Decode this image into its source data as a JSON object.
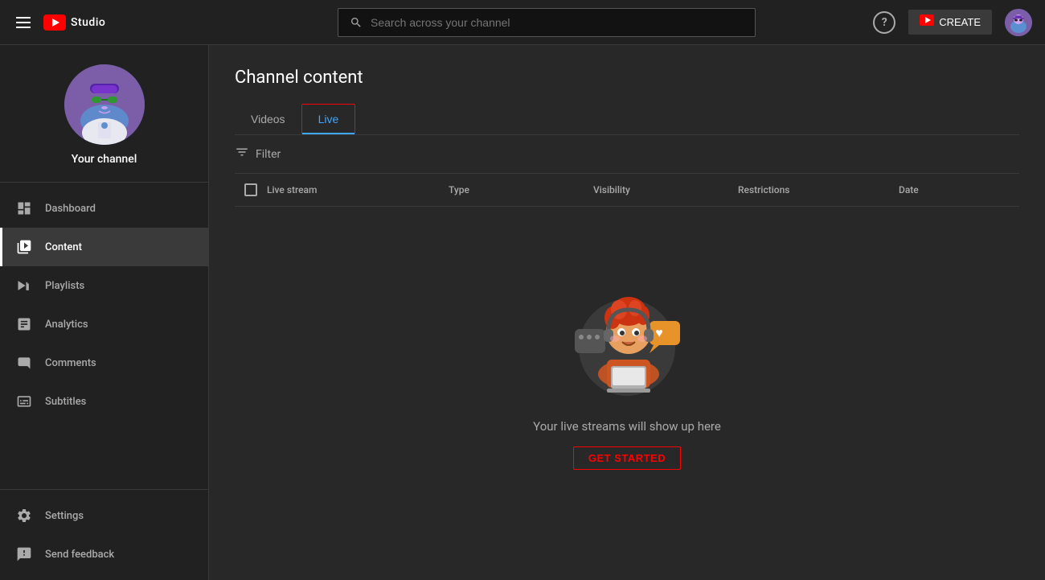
{
  "header": {
    "menu_icon": "☰",
    "logo_text": "Studio",
    "search_placeholder": "Search across your channel",
    "help_label": "?",
    "create_label": "CREATE",
    "create_icon": "▶"
  },
  "sidebar": {
    "channel_name": "Your channel",
    "nav_items": [
      {
        "id": "dashboard",
        "label": "Dashboard",
        "active": false
      },
      {
        "id": "content",
        "label": "Content",
        "active": true
      },
      {
        "id": "playlists",
        "label": "Playlists",
        "active": false
      },
      {
        "id": "analytics",
        "label": "Analytics",
        "active": false
      },
      {
        "id": "comments",
        "label": "Comments",
        "active": false
      },
      {
        "id": "subtitles",
        "label": "Subtitles",
        "active": false
      }
    ],
    "bottom_items": [
      {
        "id": "settings",
        "label": "Settings",
        "active": false
      },
      {
        "id": "feedback",
        "label": "Send feedback",
        "active": false
      }
    ]
  },
  "content": {
    "page_title": "Channel content",
    "tabs": [
      {
        "id": "videos",
        "label": "Videos",
        "active": false
      },
      {
        "id": "live",
        "label": "Live",
        "active": true
      }
    ],
    "filter_label": "Filter",
    "table_headers": {
      "live_stream": "Live stream",
      "type": "Type",
      "visibility": "Visibility",
      "restrictions": "Restrictions",
      "date": "Date"
    },
    "empty_state": {
      "text": "Your live streams will show up here",
      "cta": "GET STARTED"
    }
  }
}
